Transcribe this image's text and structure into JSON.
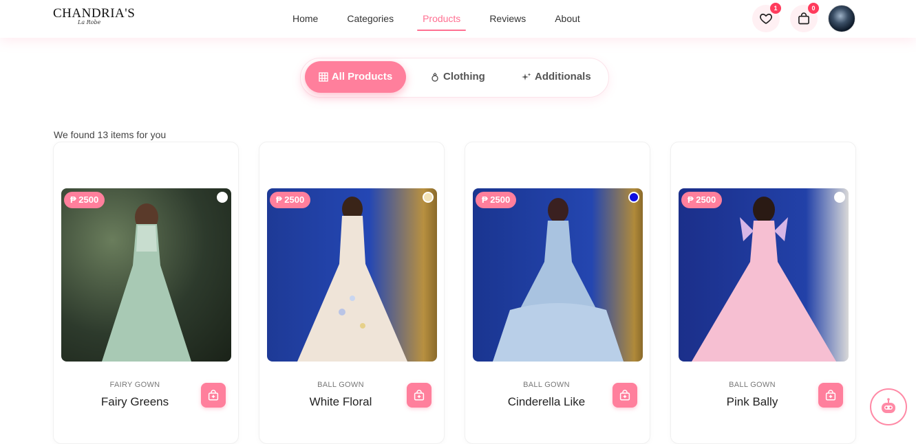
{
  "brand": {
    "name": "CHANDRIA'S",
    "tagline": "La Robe"
  },
  "nav": [
    {
      "label": "Home"
    },
    {
      "label": "Categories"
    },
    {
      "label": "Products",
      "active": true
    },
    {
      "label": "Reviews"
    },
    {
      "label": "About"
    }
  ],
  "header_actions": {
    "wishlist_count": "1",
    "cart_count": "0"
  },
  "tabs": [
    {
      "label": "All Products",
      "icon": "grid-icon",
      "active": true
    },
    {
      "label": "Clothing",
      "icon": "ring-icon"
    },
    {
      "label": "Additionals",
      "icon": "sparkle-icon"
    }
  ],
  "results_text": "We found 13 items for you",
  "products": [
    {
      "price": "₱ 2500",
      "category": "FAIRY GOWN",
      "name": "Fairy Greens",
      "swatch": "#ffffff",
      "bg": "#3b4a3a",
      "dress": "#a8c9b4"
    },
    {
      "price": "₱ 2500",
      "category": "BALL GOWN",
      "name": "White Floral",
      "swatch": "#f2e2b6",
      "bg": "#1f3c9a",
      "dress": "#efe4d8"
    },
    {
      "price": "₱ 2500",
      "category": "BALL GOWN",
      "name": "Cinderella Like",
      "swatch": "#1010e0",
      "bg": "#1d3a96",
      "dress": "#a9c3e0"
    },
    {
      "price": "₱ 2500",
      "category": "BALL GOWN",
      "name": "Pink Bally",
      "swatch": "#ffffff",
      "bg": "#1b2f8a",
      "dress": "#f6bfd2"
    }
  ],
  "colors": {
    "accent": "#ff7f9c",
    "badge": "#ff3b5c"
  }
}
